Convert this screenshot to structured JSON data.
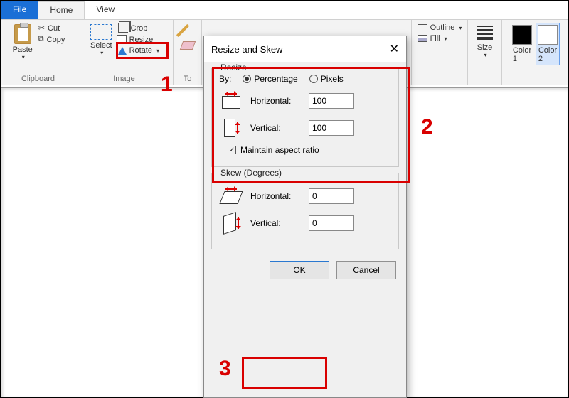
{
  "tabs": {
    "file": "File",
    "home": "Home",
    "view": "View"
  },
  "ribbon": {
    "clipboard": {
      "label": "Clipboard",
      "paste": "Paste",
      "cut": "Cut",
      "copy": "Copy"
    },
    "image": {
      "label": "Image",
      "select": "Select",
      "crop": "Crop",
      "resize": "Resize",
      "rotate": "Rotate"
    },
    "tools": {
      "label": "Tools"
    },
    "shapes": {
      "outline": "Outline",
      "fill": "Fill"
    },
    "size": {
      "label": "Size"
    },
    "colors": {
      "color1": "Color\n1",
      "color2": "Color\n2"
    }
  },
  "dialog": {
    "title": "Resize and Skew",
    "resize": {
      "legend": "Resize",
      "by": "By:",
      "percentage": "Percentage",
      "pixels": "Pixels",
      "horizontal": "Horizontal:",
      "vertical": "Vertical:",
      "h_value": "100",
      "v_value": "100",
      "maintain": "Maintain aspect ratio"
    },
    "skew": {
      "legend": "Skew (Degrees)",
      "horizontal": "Horizontal:",
      "vertical": "Vertical:",
      "h_value": "0",
      "v_value": "0"
    },
    "ok": "OK",
    "cancel": "Cancel"
  },
  "callouts": {
    "one": "1",
    "two": "2",
    "three": "3"
  }
}
